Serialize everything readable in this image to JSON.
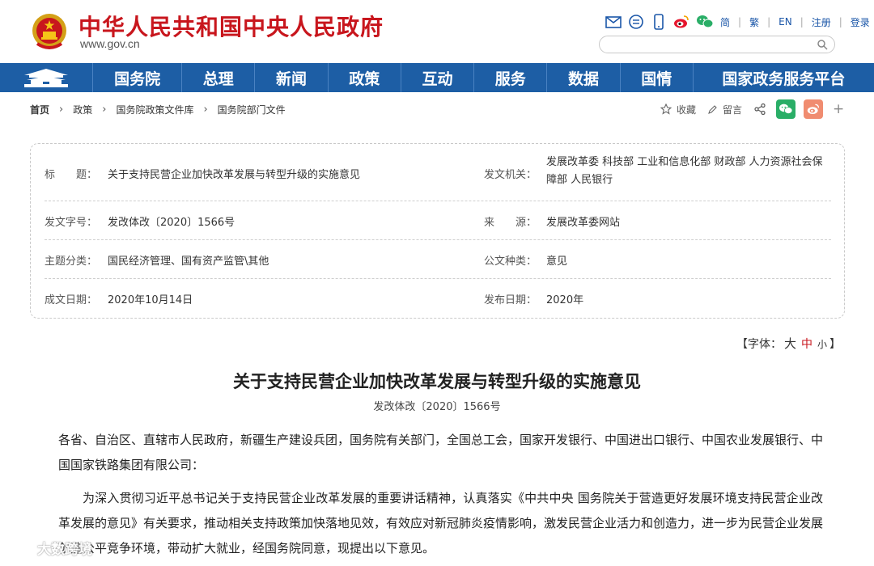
{
  "header": {
    "site_title": "中华人民共和国中央人民政府",
    "site_url": "www.gov.cn",
    "lang_simplified": "简",
    "lang_traditional": "繁",
    "lang_en": "EN",
    "register": "注册",
    "login": "登录",
    "search_placeholder": ""
  },
  "nav": {
    "items": [
      "国务院",
      "总理",
      "新闻",
      "政策",
      "互动",
      "服务",
      "数据",
      "国情",
      "国家政务服务平台"
    ]
  },
  "breadcrumb": [
    "首页",
    "政策",
    "国务院政策文件库",
    "国务院部门文件"
  ],
  "share": {
    "favorite": "收藏",
    "comment": "留言",
    "more": "+"
  },
  "info": {
    "title_label": "标　　题：",
    "title_value": "关于支持民营企业加快改革发展与转型升级的实施意见",
    "issuer_label": "发文机关：",
    "issuer_value": "发展改革委  科技部  工业和信息化部  财政部  人力资源社会保障部  人民银行",
    "docno_label": "发文字号：",
    "docno_value": "发改体改〔2020〕1566号",
    "source_label": "来　　源：",
    "source_value": "发展改革委网站",
    "topic_label": "主题分类：",
    "topic_value": "国民经济管理、国有资产监管\\其他",
    "type_label": "公文种类：",
    "type_value": "意见",
    "date_label": "成文日期：",
    "date_value": "2020年10月14日",
    "pub_label": "发布日期：",
    "pub_value": "2020年"
  },
  "font_control": {
    "prefix": "【字体：",
    "large": "大",
    "medium": "中",
    "small": "小",
    "suffix": "】"
  },
  "article": {
    "title": "关于支持民营企业加快改革发展与转型升级的实施意见",
    "doc_number": "发改体改〔2020〕1566号",
    "paragraph1": "各省、自治区、直辖市人民政府，新疆生产建设兵团，国务院有关部门，全国总工会，国家开发银行、中国进出口银行、中国农业发展银行、中国国家铁路集团有限公司：",
    "paragraph2": "为深入贯彻习近平总书记关于支持民营企业改革发展的重要讲话精神，认真落实《中共中央 国务院关于营造更好发展环境支持民营企业改革发展的意见》有关要求，推动相关支持政策加快落地见效，有效应对新冠肺炎疫情影响，激发民营企业活力和创造力，进一步为民营企业发展创造公平竞争环境，带动扩大就业，经国务院同意，现提出以下意见。"
  },
  "watermark": {
    "text": "大数跨境"
  },
  "colors": {
    "brand_red": "#c8161d",
    "nav_blue": "#1d5ea5",
    "link_blue": "#1a56a8"
  }
}
